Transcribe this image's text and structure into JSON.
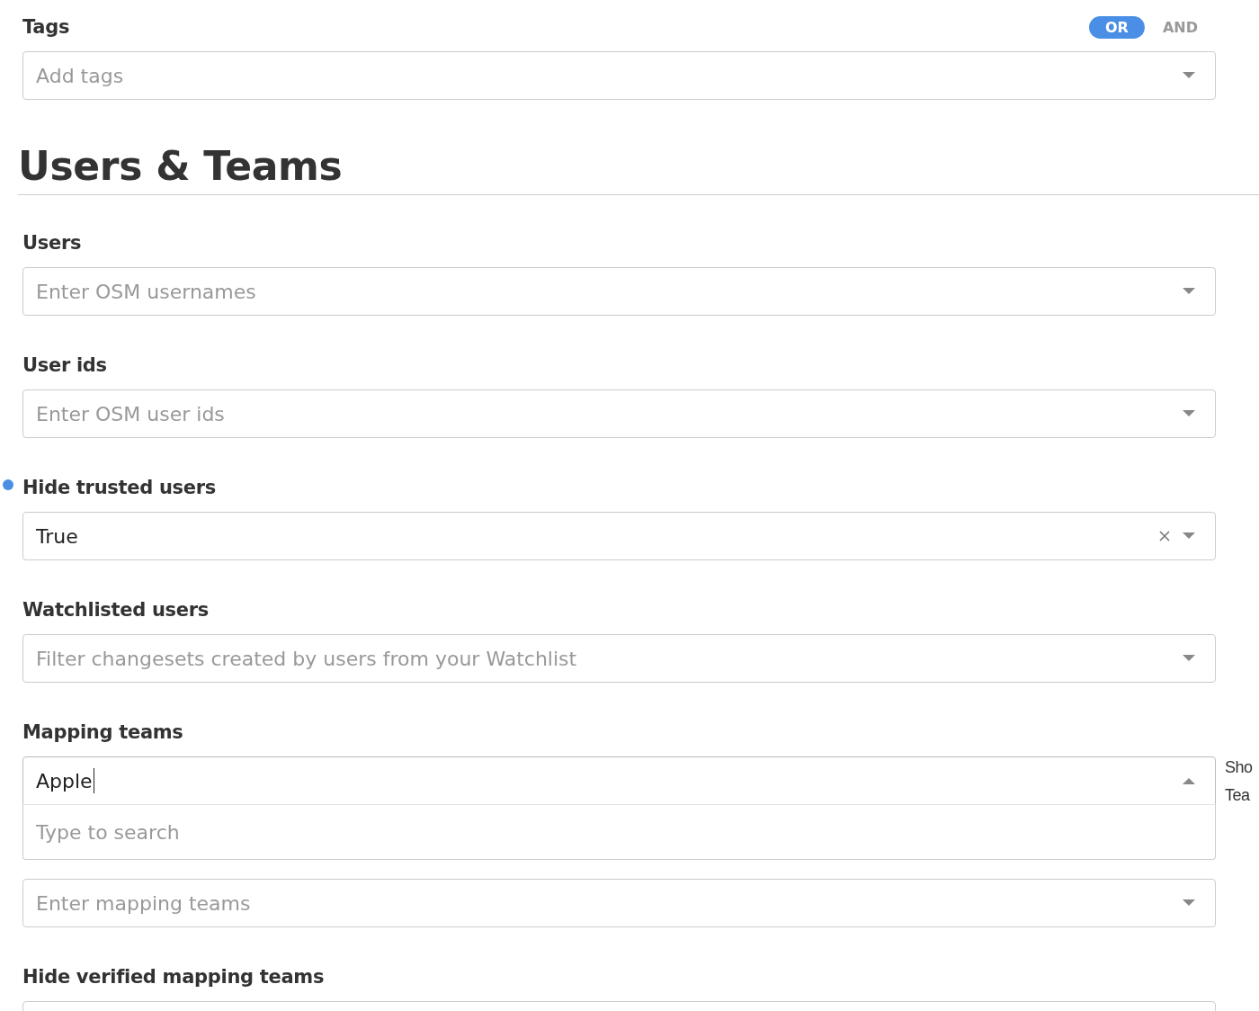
{
  "tags": {
    "label": "Tags",
    "modes": [
      {
        "label": "OR",
        "selected": true
      },
      {
        "label": "AND",
        "selected": false
      }
    ],
    "placeholder": "Add tags"
  },
  "section": {
    "title": "Users & Teams"
  },
  "filters": [
    {
      "label": "Users",
      "placeholder": "Enter OSM usernames",
      "modified": false,
      "open": false
    },
    {
      "label": "User ids",
      "placeholder": "Enter OSM user ids",
      "modified": false,
      "open": false
    },
    {
      "label": "Hide trusted users",
      "value": "True",
      "modified": true,
      "open": false
    },
    {
      "label": "Watchlisted users",
      "placeholder": "Filter changesets created by users from your Watchlist",
      "modified": false,
      "open": false
    },
    {
      "label": "Mapping teams",
      "value": "Apple",
      "menu_text": "Type to search",
      "side_note": [
        "Sho",
        "Tea"
      ],
      "modified": false,
      "open": true
    },
    {
      "placeholder": "Enter mapping teams",
      "modified": false,
      "open": false
    },
    {
      "label": "Hide verified mapping teams",
      "modified": false,
      "open": false
    }
  ]
}
